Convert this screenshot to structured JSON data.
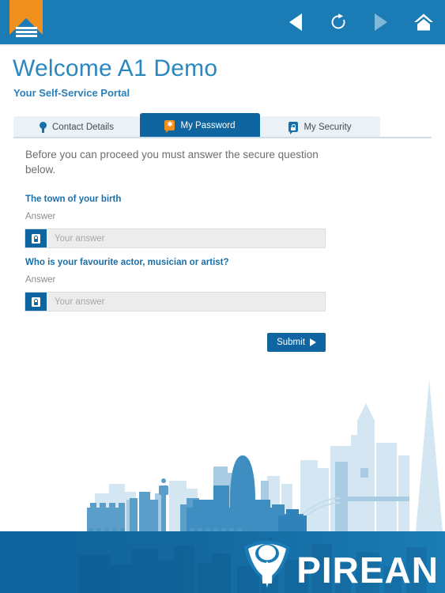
{
  "header": {
    "logo_icon": "pirean-flag-logo",
    "menu_icon": "hamburger-menu-icon",
    "nav": [
      {
        "icon": "back-arrow-icon",
        "name": "back-button",
        "state": "enabled"
      },
      {
        "icon": "refresh-icon",
        "name": "refresh-button",
        "state": "enabled"
      },
      {
        "icon": "forward-arrow-icon",
        "name": "forward-button",
        "state": "disabled"
      },
      {
        "icon": "home-icon",
        "name": "home-button",
        "state": "enabled"
      }
    ]
  },
  "page": {
    "title": "Welcome A1 Demo",
    "subtitle": "Your Self-Service Portal"
  },
  "tabs": [
    {
      "label": "Contact Details",
      "icon": "location-pin-icon",
      "active": false
    },
    {
      "label": "My Password",
      "icon": "password-asterisk-icon",
      "active": true
    },
    {
      "label": "My Security",
      "icon": "padlock-icon",
      "active": false
    }
  ],
  "form": {
    "instruction": "Before you can proceed you must answer the secure question below.",
    "answer_label": "Answer",
    "field_icon": "padlock-icon",
    "questions": [
      {
        "question": "The town of your birth",
        "answer_label": "Answer",
        "placeholder": "Your answer",
        "value": ""
      },
      {
        "question": "Who is your favourite actor, musician or artist?",
        "answer_label": "Answer",
        "placeholder": "Your answer",
        "value": ""
      }
    ],
    "submit_label": "Submit"
  },
  "footer": {
    "brand": "PIREAN",
    "logo_icon": "pirean-tulip-logo"
  },
  "colors": {
    "header_blue": "#1b7cb5",
    "accent_orange": "#f0901e",
    "active_tab_blue": "#0f65a0",
    "tab_inactive": "#eaf2f7",
    "title_blue": "#2b87c0",
    "question_blue": "#1b6fa8",
    "field_grey": "#ececec"
  }
}
